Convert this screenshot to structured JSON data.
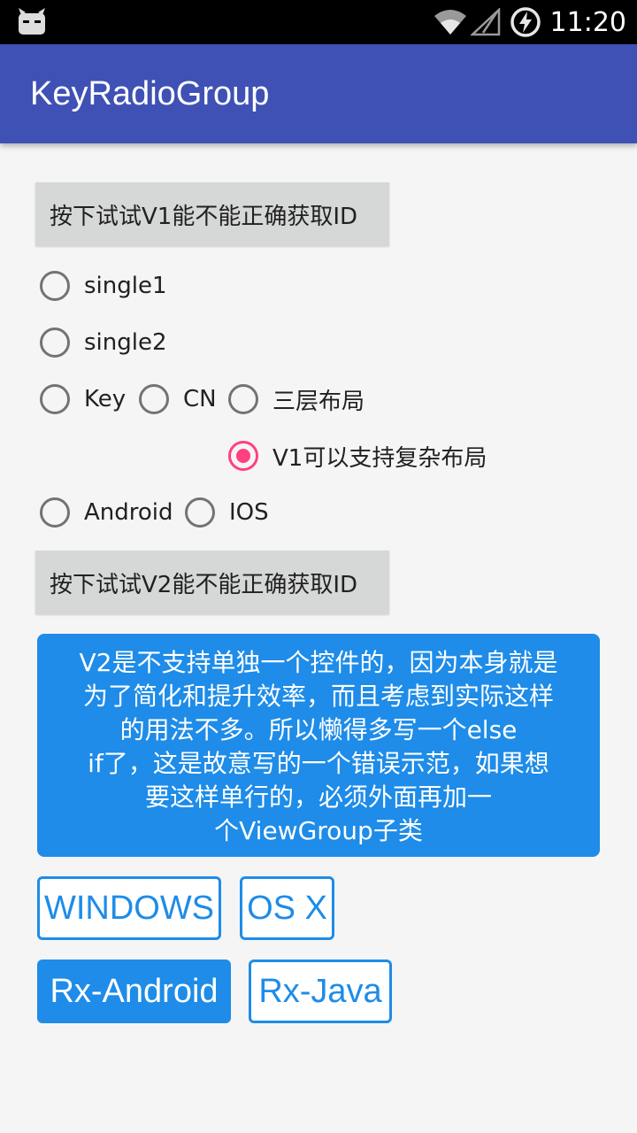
{
  "statusbar": {
    "time": "11:20"
  },
  "appbar": {
    "title": "KeyRadioGroup"
  },
  "buttons": {
    "v1": "按下试试V1能不能正确获取ID",
    "v2": "按下试试V2能不能正确获取ID"
  },
  "radios": {
    "single1": "single1",
    "single2": "single2",
    "key": "Key",
    "cn": "CN",
    "three_layer": "三层布局",
    "v1_complex": "V1可以支持复杂布局",
    "android": "Android",
    "ios": "IOS",
    "checked": "V1可以支持复杂布局"
  },
  "info": {
    "lines": [
      "V2是不支持单独一个控件的，因为本身就是",
      "为了简化和提升效率，而且考虑到实际这样",
      "的用法不多。所以懒得多写一个else",
      "if了，这是故意写的一个错误示范，如果想",
      "要这样单行的，必须外面再加一",
      "个ViewGroup子类"
    ]
  },
  "chips": {
    "windows": "WINDOWS",
    "osx": "OS X",
    "rx_android": "Rx-Android",
    "rx_java": "Rx-Java",
    "active": "Rx-Android"
  },
  "colors": {
    "primary": "#3f51b5",
    "accent": "#ff4081",
    "blue": "#1e8ce8"
  }
}
